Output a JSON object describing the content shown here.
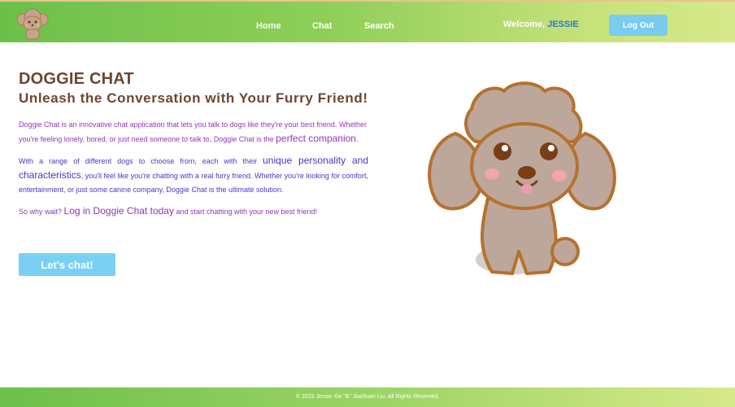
{
  "header": {
    "nav": [
      "Home",
      "Chat",
      "Search"
    ],
    "welcome_prefix": "Welcome, ",
    "username": "JESSIE",
    "logout_label": "Log Out"
  },
  "main": {
    "title": "DOGGIE CHAT",
    "subtitle": "Unleash the Conversation with Your Furry Friend!",
    "p1_a": "Doggie Chat is an innovative chat application that lets you talk to dogs like they're your best friend. Whether you're feeling lonely, bored, or just need someone to talk to, Doggie Chat is the ",
    "p1_em": "perfect companion",
    "p1_b": ".",
    "p2_a": "With a range of different dogs to choose from, each with their ",
    "p2_em": "unique personality and characteristics",
    "p2_b": ", you'll feel like you're chatting with a real furry friend. Whether you're looking for comfort, entertainment, or just some canine company, Doggie Chat is the ultimate solution.",
    "p3_a": "So why wait? ",
    "p3_em": "Log in Doggie Chat today",
    "p3_b": " and start chatting with your new best friend!",
    "cta_label": "Let's chat!"
  },
  "footer": {
    "text": "© 2023 Jessie Xie \"&\" Jiachuan Liu. All Rights Reserved."
  }
}
